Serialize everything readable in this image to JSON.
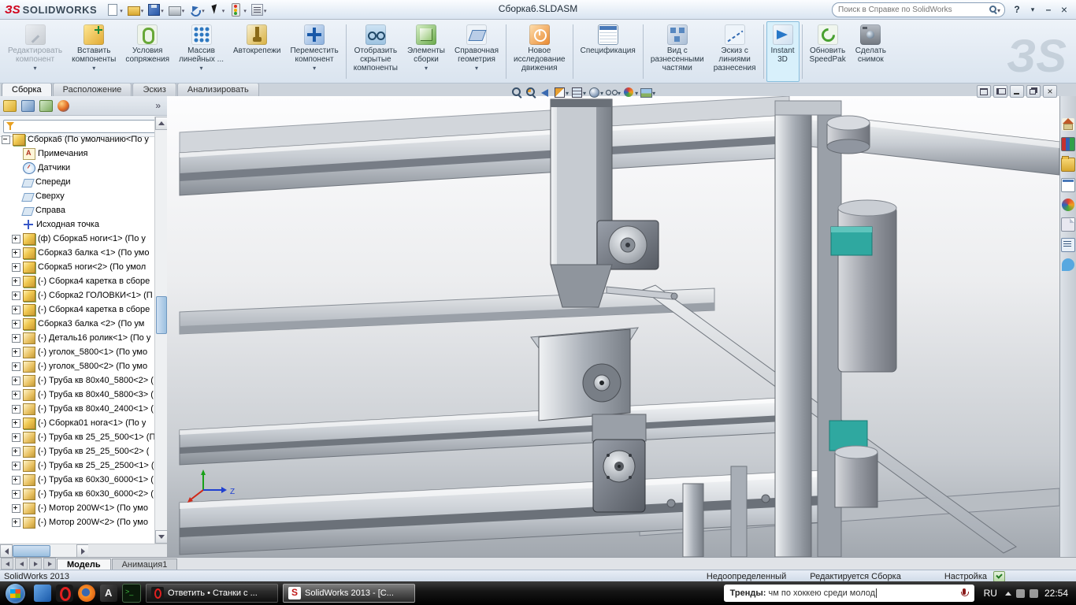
{
  "titlebar": {
    "logo_text": "SOLIDWORKS",
    "doc_title": "Сборка6.SLDASM",
    "search_placeholder": "Поиск в Справке по SolidWorks",
    "quick_icons": [
      "new-file",
      "open-file",
      "save",
      "print",
      "undo",
      "select",
      "rebuild",
      "options"
    ],
    "window_icons": [
      "help",
      "expand",
      "minimize",
      "close"
    ]
  },
  "ribbon": {
    "buttons": [
      {
        "label": "Редактировать\nкомпонент",
        "icon": "edit-component",
        "disabled": true,
        "dropdown": true
      },
      {
        "label": "Вставить\nкомпоненты",
        "icon": "insert-components",
        "dropdown": true
      },
      {
        "label": "Условия\nсопряжения",
        "icon": "mates"
      },
      {
        "label": "Массив\nлинейных ...",
        "icon": "linear-pattern",
        "dropdown": true
      },
      {
        "label": "Автокрепежи",
        "icon": "smart-fasteners"
      },
      {
        "label": "Переместить\nкомпонент",
        "icon": "move-component",
        "dropdown": true,
        "sep_after": true
      },
      {
        "label": "Отобразить\nскрытые\nкомпоненты",
        "icon": "show-hidden"
      },
      {
        "label": "Элементы\nсборки",
        "icon": "assembly-features",
        "dropdown": true
      },
      {
        "label": "Справочная\nгеометрия",
        "icon": "reference-geometry",
        "dropdown": true,
        "sep_after": true
      },
      {
        "label": "Новое\nисследование\nдвижения",
        "icon": "motion-study",
        "sep_after": true
      },
      {
        "label": "Спецификация",
        "icon": "bom",
        "sep_after": true
      },
      {
        "label": "Вид с\nразнесенными\nчастями",
        "icon": "exploded-view"
      },
      {
        "label": "Эскиз с\nлиниями\nразнесения",
        "icon": "explode-lines",
        "sep_after": true
      },
      {
        "label": "Instant\n3D",
        "icon": "instant3d",
        "active": true,
        "sep_after": true
      },
      {
        "label": "Обновить\nSpeedPak",
        "icon": "speedpak"
      },
      {
        "label": "Сделать\nснимок",
        "icon": "snapshot"
      }
    ]
  },
  "command_tabs": [
    {
      "label": "Сборка",
      "name": "tab-assembly",
      "active": true
    },
    {
      "label": "Расположение",
      "name": "tab-layout"
    },
    {
      "label": "Эскиз",
      "name": "tab-sketch"
    },
    {
      "label": "Анализировать",
      "name": "tab-evaluate"
    }
  ],
  "feature_panel": {
    "tabs": [
      "features",
      "properties",
      "configurations",
      "display"
    ],
    "tree": [
      {
        "label": "Сборка6 (По умолчанию<По у",
        "icon": "assembly-root",
        "expander": "minus",
        "root": true
      },
      {
        "label": "Примечания",
        "icon": "annotations",
        "expander": "none"
      },
      {
        "label": "Датчики",
        "icon": "sensors",
        "expander": "none"
      },
      {
        "label": "Спереди",
        "icon": "plane",
        "expander": "none"
      },
      {
        "label": "Сверху",
        "icon": "plane",
        "expander": "none"
      },
      {
        "label": "Справа",
        "icon": "plane",
        "expander": "none"
      },
      {
        "label": "Исходная точка",
        "icon": "origin",
        "expander": "none"
      },
      {
        "label": "(ф) Сборка5 ноги<1> (По у",
        "icon": "assembly",
        "expander": "plus"
      },
      {
        "label": "Сборка3 балка <1> (По умо",
        "icon": "assembly",
        "expander": "plus"
      },
      {
        "label": "Сборка5 ноги<2> (По умол",
        "icon": "assembly",
        "expander": "plus"
      },
      {
        "label": "(-) Сборка4 каретка в сборе",
        "icon": "assembly",
        "expander": "plus"
      },
      {
        "label": "(-) Сборка2 ГОЛОВКИ<1> (П",
        "icon": "assembly",
        "expander": "plus"
      },
      {
        "label": "(-) Сборка4 каретка в сборе",
        "icon": "assembly",
        "expander": "plus"
      },
      {
        "label": "Сборка3 балка <2> (По ум",
        "icon": "assembly",
        "expander": "plus"
      },
      {
        "label": "(-) Деталь16 ролик<1> (По у",
        "icon": "part",
        "expander": "plus"
      },
      {
        "label": "(-) уголок_5800<1> (По умо",
        "icon": "part",
        "expander": "plus"
      },
      {
        "label": "(-) уголок_5800<2> (По умо",
        "icon": "part",
        "expander": "plus"
      },
      {
        "label": "(-) Труба кв 80x40_5800<2> (",
        "icon": "part",
        "expander": "plus"
      },
      {
        "label": "(-) Труба кв 80x40_5800<3> (",
        "icon": "part",
        "expander": "plus"
      },
      {
        "label": "(-) Труба кв 80x40_2400<1> (",
        "icon": "part",
        "expander": "plus"
      },
      {
        "label": "(-) Сборка01 нога<1> (По у",
        "icon": "assembly",
        "expander": "plus"
      },
      {
        "label": "(-) Труба кв 25_25_500<1> (П",
        "icon": "part",
        "expander": "plus"
      },
      {
        "label": "(-) Труба кв 25_25_500<2> (",
        "icon": "part",
        "expander": "plus"
      },
      {
        "label": "(-) Труба кв 25_25_2500<1> (",
        "icon": "part",
        "expander": "plus"
      },
      {
        "label": "(-) Труба кв 60x30_6000<1> (",
        "icon": "part",
        "expander": "plus"
      },
      {
        "label": "(-) Труба кв 60x30_6000<2> (",
        "icon": "part",
        "expander": "plus"
      },
      {
        "label": "(-) Мотор 200W<1> (По умо",
        "icon": "part",
        "expander": "plus"
      },
      {
        "label": "(-) Мотор 200W<2> (По умо",
        "icon": "part",
        "expander": "plus"
      }
    ]
  },
  "hud": [
    {
      "icon": "zoom-fit"
    },
    {
      "icon": "zoom-area"
    },
    {
      "icon": "previous-view"
    },
    {
      "icon": "section-view",
      "dropdown": true
    },
    {
      "icon": "view-orientation",
      "dropdown": true
    },
    {
      "icon": "display-style",
      "dropdown": true
    },
    {
      "icon": "hide-show-items",
      "dropdown": true
    },
    {
      "icon": "edit-appearance",
      "dropdown": true
    },
    {
      "icon": "scene",
      "dropdown": true
    }
  ],
  "task_pane": [
    "resources",
    "design-library",
    "file-explorer",
    "view-palette",
    "appearances",
    "decals",
    "custom-properties",
    "forum"
  ],
  "viewport": {
    "origin_axis_label": "Z"
  },
  "model_tabs": [
    {
      "label": "Модель",
      "active": true
    },
    {
      "label": "Анимация1"
    }
  ],
  "status_bar": {
    "app": "SolidWorks 2013",
    "state": "Недоопределенный",
    "mode": "Редактируется Сборка",
    "settings": "Настройка"
  },
  "taskbar": {
    "quick_icons": [
      "explorer",
      "opera",
      "firefox",
      "aimp",
      "console"
    ],
    "tasks": [
      {
        "label": "Ответить • Станки с ...",
        "icon": "opera"
      },
      {
        "label": "SolidWorks 2013 - [C...",
        "icon": "solidworks",
        "active": true
      }
    ],
    "search_bold": "Тренды:",
    "search_text": " чм по хоккею среди молод",
    "lang": "RU",
    "clock": "22:54"
  }
}
